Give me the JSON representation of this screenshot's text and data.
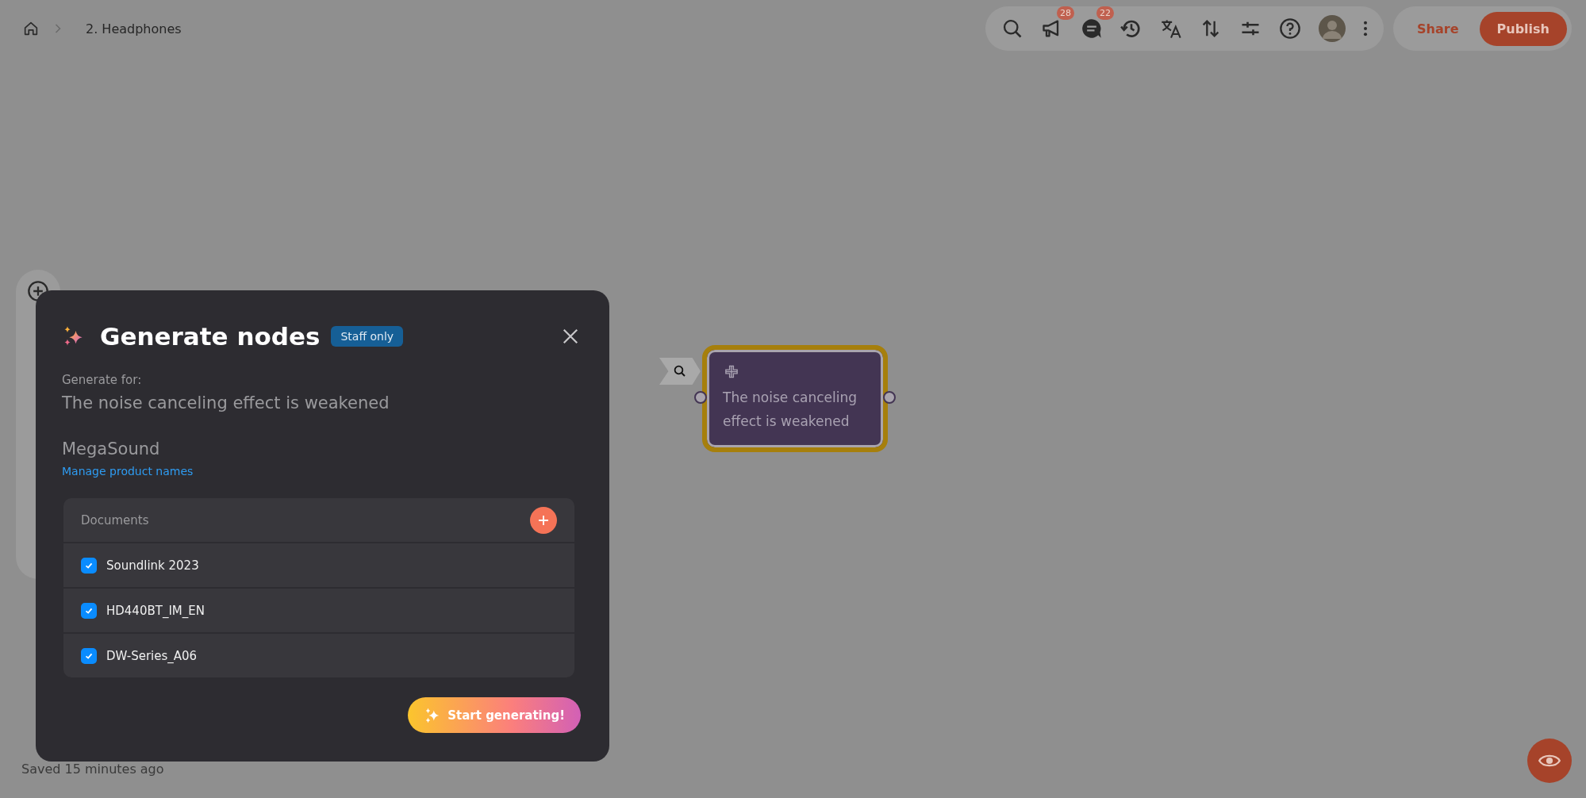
{
  "breadcrumb": {
    "current": "2. Headphones"
  },
  "toolbar": {
    "announcements_count": "28",
    "comments_count": "22"
  },
  "share": "Share",
  "publish": "Publish",
  "node": {
    "text": "The noise canceling effect is weakened",
    "selected": true
  },
  "modal": {
    "title": "Generate nodes",
    "badge": "Staff only",
    "generate_for_label": "Generate for:",
    "target": "The noise canceling effect is weakened",
    "product": "MegaSound",
    "manage_link": "Manage product names",
    "documents": {
      "title": "Documents",
      "items": [
        {
          "name": "Soundlink 2023",
          "checked": true
        },
        {
          "name": "HD440BT_IM_EN",
          "checked": true
        },
        {
          "name": "DW-Series_A06",
          "checked": true
        }
      ]
    },
    "action": "Start generating!"
  },
  "status": "Saved 15 minutes ago"
}
